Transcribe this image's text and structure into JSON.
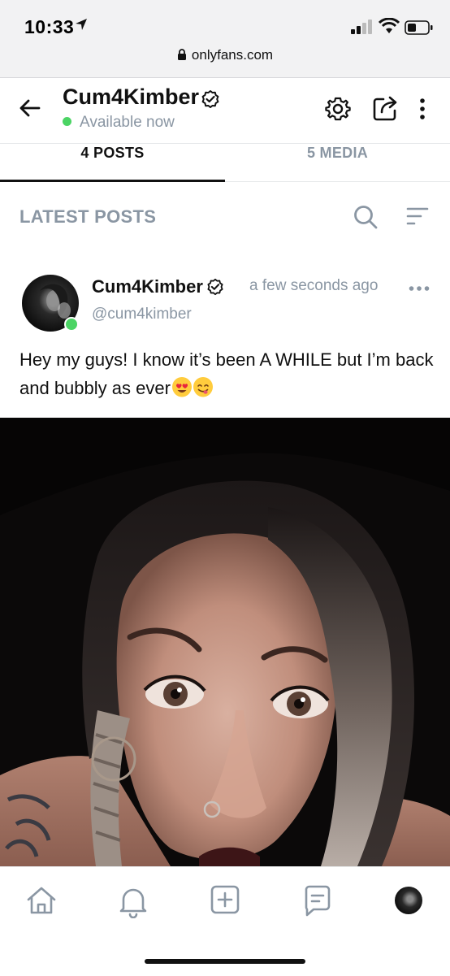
{
  "status_bar": {
    "time": "10:33"
  },
  "browser": {
    "url": "onlyfans.com"
  },
  "profile": {
    "name": "Cum4Kimber",
    "availability": "Available now"
  },
  "tabs": [
    {
      "label": "4 POSTS",
      "active": true
    },
    {
      "label": "5 MEDIA",
      "active": false
    }
  ],
  "section": {
    "title": "LATEST POSTS"
  },
  "post": {
    "author_name": "Cum4Kimber",
    "handle": "@cum4kimber",
    "timestamp": "a few seconds ago",
    "text": "Hey my guys! I know it’s been A WHILE but I’m back and bubbly as ever",
    "emojis": [
      "heart-eyes-emoji",
      "yum-emoji"
    ]
  },
  "colors": {
    "online_green": "#4bd464",
    "muted_gray": "#8a96a3",
    "text_dark": "#111111"
  },
  "bottom_nav": [
    "home-icon",
    "bell-icon",
    "add-post-icon",
    "messages-icon",
    "profile-avatar"
  ]
}
